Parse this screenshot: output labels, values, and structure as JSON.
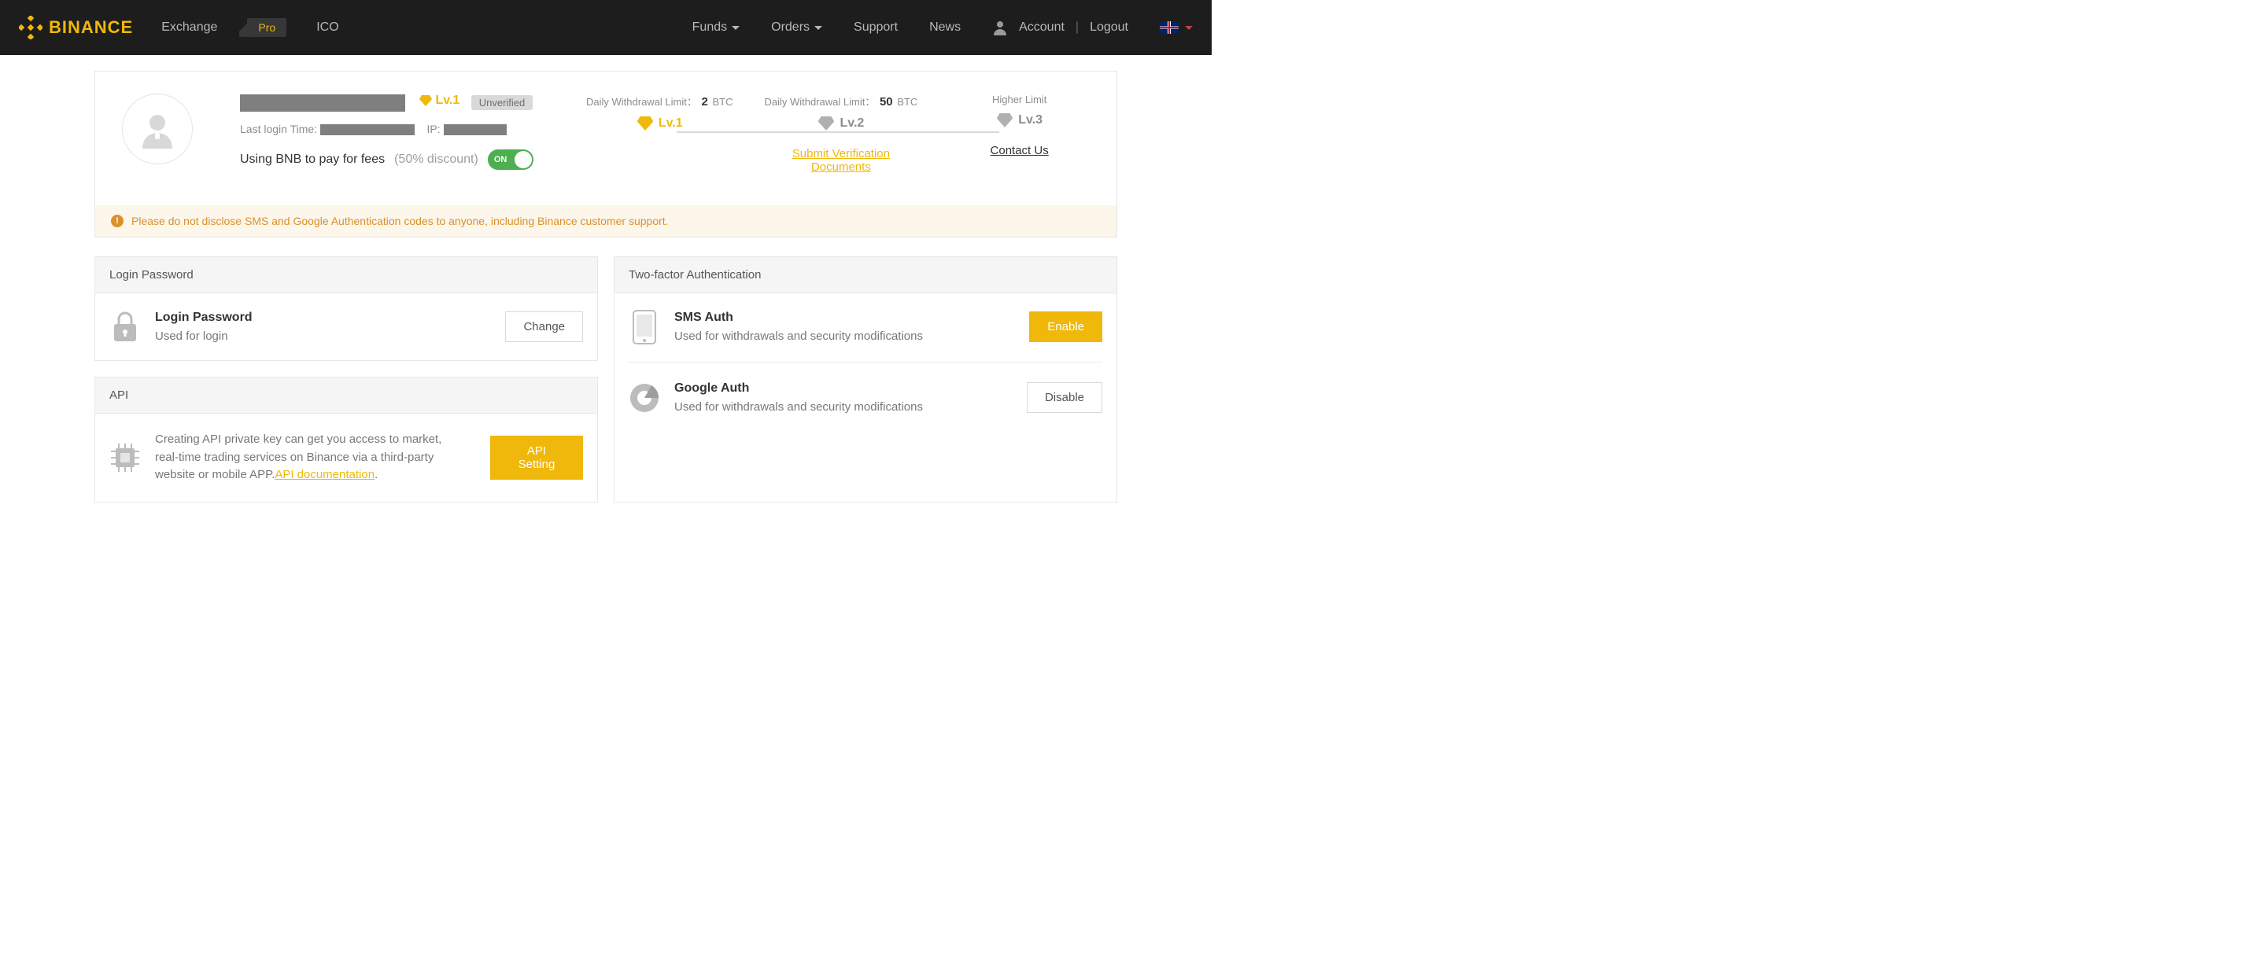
{
  "brand": "BINANCE",
  "nav": {
    "exchange": "Exchange",
    "pro": "Pro",
    "ico": "ICO",
    "funds": "Funds",
    "orders": "Orders",
    "support": "Support",
    "news": "News",
    "account": "Account",
    "logout": "Logout"
  },
  "account": {
    "level_label": "Lv.1",
    "verify_badge": "Unverified",
    "last_login_label": "Last login Time:",
    "ip_label": "IP:",
    "fee_text": "Using BNB to pay for fees",
    "fee_discount": "(50% discount)",
    "toggle_label": "ON"
  },
  "levels": {
    "withdraw_label": "Daily Withdrawal Limit：",
    "lv1_val": "2",
    "lv2_val": "50",
    "unit": "BTC",
    "higher": "Higher Limit",
    "lv1": "Lv.1",
    "lv2": "Lv.2",
    "lv3": "Lv.3",
    "submit_docs": "Submit Verification Documents",
    "contact": "Contact Us"
  },
  "warning": "Please do not disclose SMS and Google Authentication codes to anyone, including Binance customer support.",
  "login_pw": {
    "head": "Login Password",
    "title": "Login Password",
    "desc": "Used for login",
    "btn": "Change"
  },
  "api": {
    "head": "API",
    "desc1": "Creating API private key can get you access to market, real-time trading services on Binance via a third-party website or mobile APP.",
    "doc": "API documentation",
    "btn": "API Setting"
  },
  "twofa": {
    "head": "Two-factor Authentication",
    "sms_title": "SMS Auth",
    "sms_desc": "Used for withdrawals and security modifications",
    "sms_btn": "Enable",
    "ga_title": "Google Auth",
    "ga_desc": "Used for withdrawals and security modifications",
    "ga_btn": "Disable"
  }
}
